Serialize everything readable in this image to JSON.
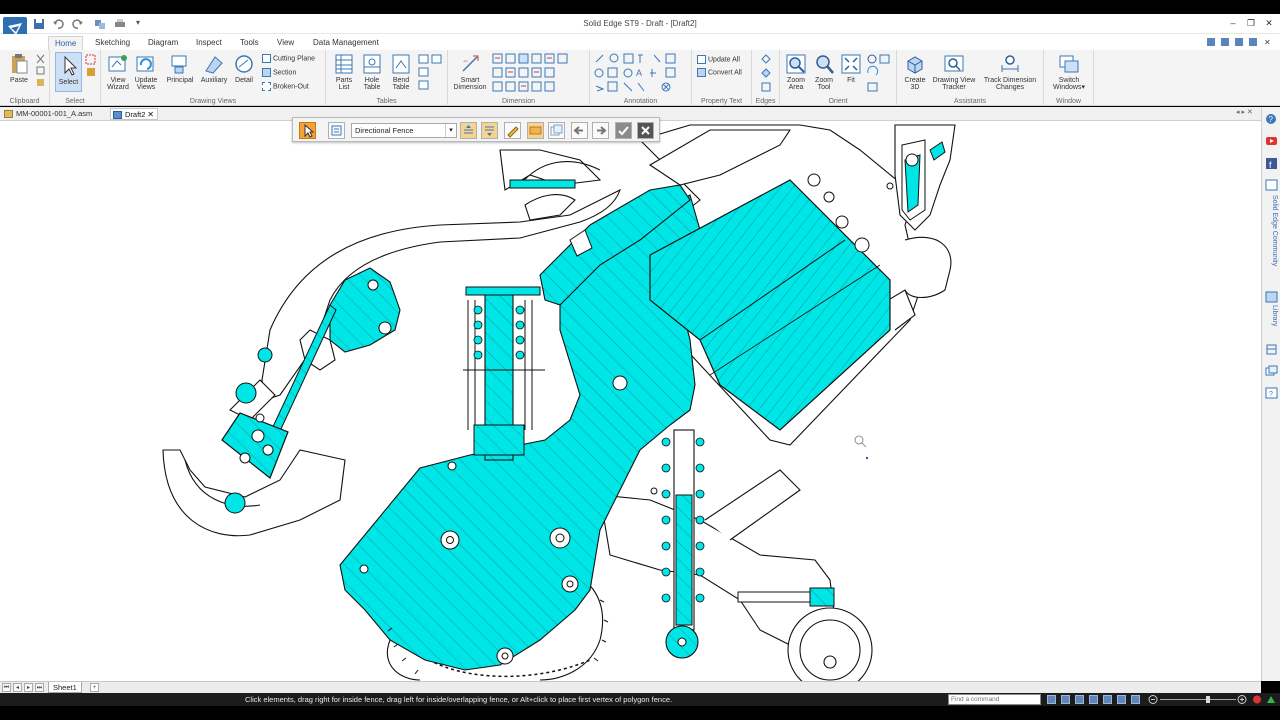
{
  "window": {
    "title": "Solid Edge ST9 - Draft - [Draft2]"
  },
  "tabs": [
    {
      "label": "Home",
      "active": true
    },
    {
      "label": "Sketching"
    },
    {
      "label": "Diagram"
    },
    {
      "label": "Inspect"
    },
    {
      "label": "Tools"
    },
    {
      "label": "View"
    },
    {
      "label": "Data Management"
    }
  ],
  "ribbon": {
    "clipboard": {
      "label": "Clipboard",
      "paste": "Paste"
    },
    "select": {
      "label": "Select",
      "select": "Select"
    },
    "drawing_views": {
      "label": "Drawing Views",
      "view_wizard": [
        "View",
        "Wizard"
      ],
      "update_views": [
        "Update",
        "Views"
      ],
      "principal": "Principal",
      "auxiliary": "Auxiliary",
      "detail": "Detail",
      "cutting_plane": "Cutting Plane",
      "section": "Section",
      "broken_out": "Broken-Out"
    },
    "tables": {
      "label": "Tables",
      "parts_list": [
        "Parts",
        "List"
      ],
      "hole_table": [
        "Hole",
        "Table"
      ],
      "bend_table": [
        "Bend",
        "Table"
      ]
    },
    "dimension": {
      "label": "Dimension",
      "smart_dimension": [
        "Smart",
        "Dimension"
      ]
    },
    "annotation": {
      "label": "Annotation"
    },
    "property_text": {
      "label": "Property Text",
      "update_all": "Update All",
      "convert_all": "Convert All"
    },
    "edges": {
      "label": "Edges"
    },
    "orient": {
      "label": "Orient",
      "zoom_area": [
        "Zoom",
        "Area"
      ],
      "zoom_tool": [
        "Zoom",
        "Tool"
      ],
      "fit": "Fit"
    },
    "assistants": {
      "label": "Assistants",
      "create_3d": [
        "Create",
        "3D"
      ],
      "drawing_view_tracker": [
        "Drawing View",
        "Tracker"
      ],
      "track_dimension_changes": [
        "Track Dimension",
        "Changes"
      ]
    },
    "window": {
      "label": "Window",
      "switch_windows": [
        "Switch",
        "Windows"
      ]
    }
  },
  "documents": [
    {
      "label": "MM-00001-001_A.asm"
    },
    {
      "label": "Draft2",
      "active": true
    }
  ],
  "fence_toolbar": {
    "mode": "Directional Fence"
  },
  "right_panel": {
    "community": "Solid Edge Community",
    "library": "Library"
  },
  "sheets": [
    {
      "label": "Sheet1",
      "active": true
    }
  ],
  "status": {
    "prompt": "Click elements, drag right for inside fence, drag left for inside/overlapping fence, or Alt+click to place first vertex of polygon fence.",
    "command_placeholder": "Find a command"
  },
  "colors": {
    "section_fill": "#00e5e5",
    "accent": "#2e6fb4",
    "active_tool": "#f4a23a"
  }
}
